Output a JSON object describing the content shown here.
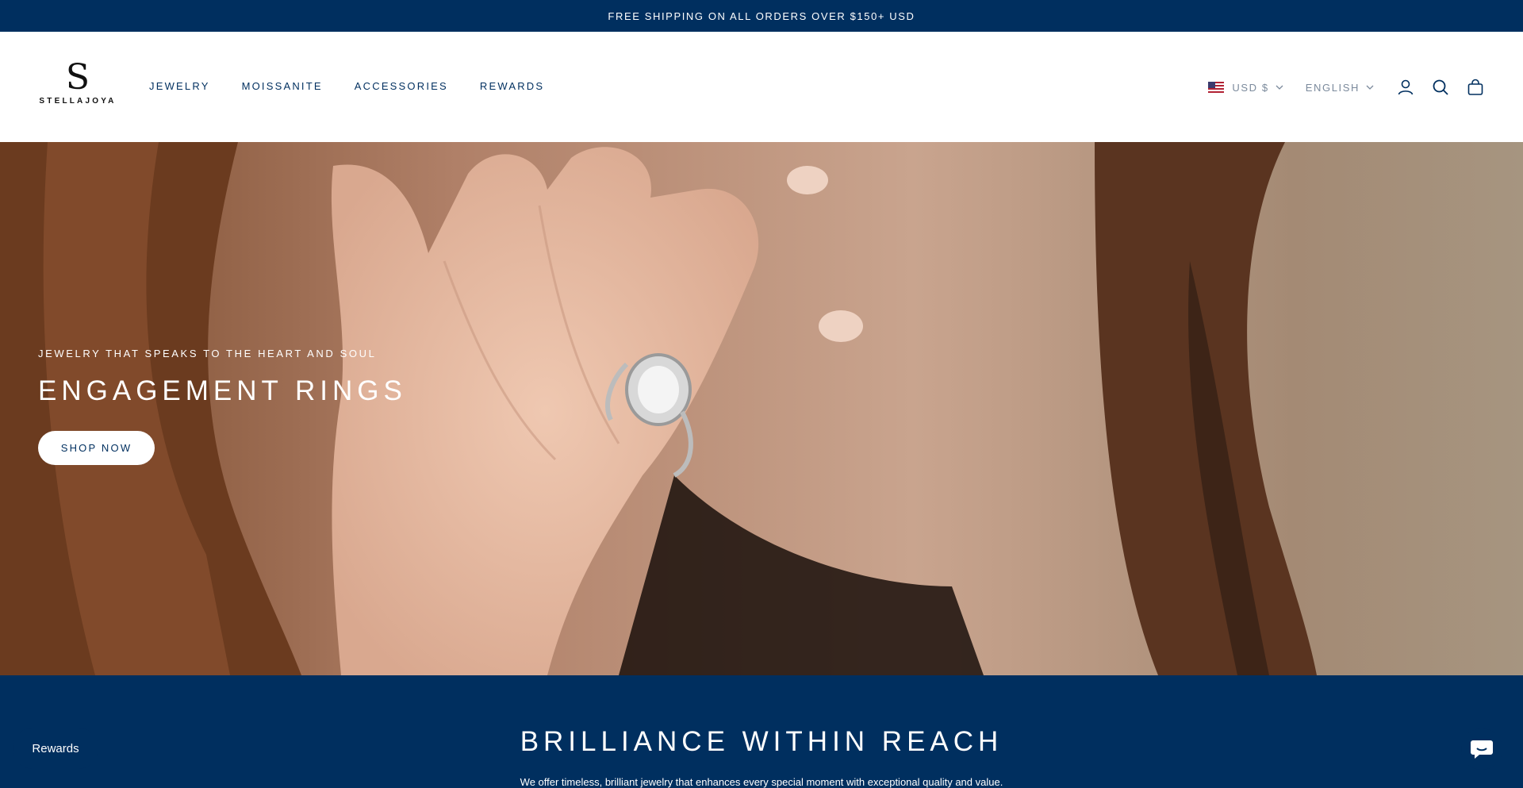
{
  "announcement": {
    "text": "FREE SHIPPING ON ALL ORDERS OVER $150+ USD"
  },
  "header": {
    "logo": {
      "mark": "S",
      "text": "STELLAJOYA"
    },
    "nav": [
      {
        "label": "JEWELRY"
      },
      {
        "label": "MOISSANITE"
      },
      {
        "label": "ACCESSORIES"
      },
      {
        "label": "REWARDS"
      }
    ],
    "currency": {
      "label": "USD $",
      "flag": "us-flag-icon"
    },
    "language": {
      "label": "ENGLISH"
    },
    "icons": [
      "account-icon",
      "search-icon",
      "cart-icon"
    ]
  },
  "hero": {
    "kicker": "JEWELRY THAT SPEAKS TO THE HEART AND SOUL",
    "title": "ENGAGEMENT RINGS",
    "cta": "SHOP NOW"
  },
  "intro": {
    "title": "BRILLIANCE WITHIN REACH",
    "text": "We offer timeless, brilliant jewelry that enhances every special moment with exceptional quality and value."
  },
  "widgets": {
    "rewards_label": "Rewards",
    "chat_icon": "chat-bubble-icon"
  },
  "colors": {
    "brand_navy": "#002f5f",
    "nav_text": "#002f5f",
    "muted_text": "#7b8a9c",
    "white": "#ffffff"
  }
}
